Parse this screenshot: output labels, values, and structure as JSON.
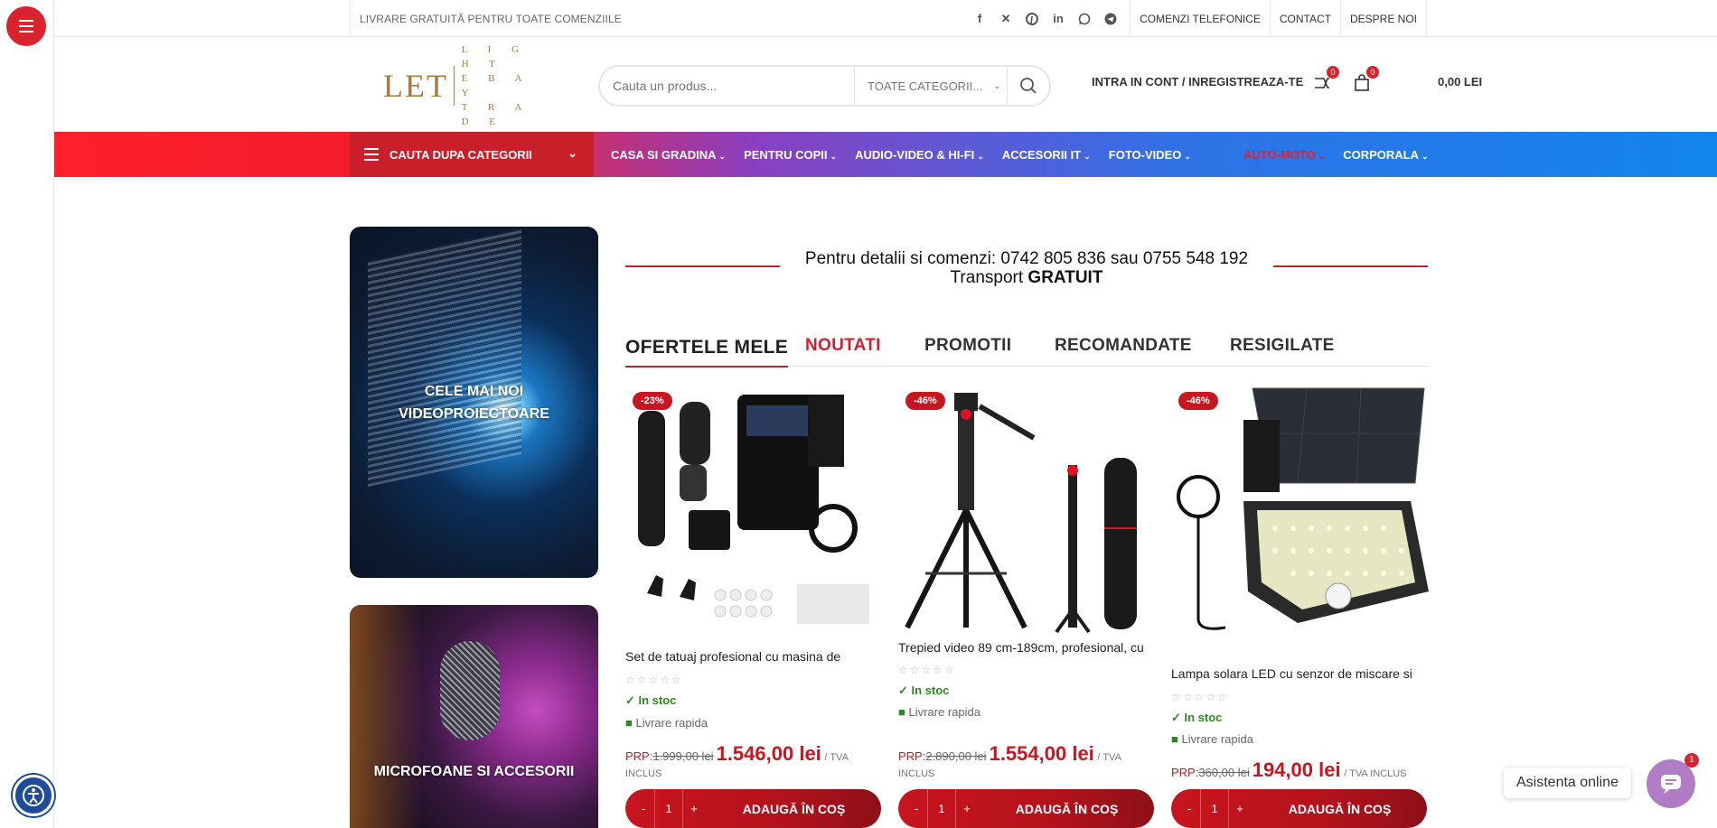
{
  "topbar": {
    "promo": "LIVRARE GRATUITĂ PENTRU TOATE COMENZIILE",
    "social_icons": [
      "facebook-icon",
      "x-icon",
      "pinterest-icon",
      "linkedin-icon",
      "whatsapp-icon",
      "telegram-icon"
    ],
    "links": [
      "COMENZI TELEFONICE",
      "CONTACT",
      "DESPRE NOI"
    ]
  },
  "header": {
    "logo_main": "LET",
    "logo_lines": [
      "L I G H T",
      "E B A Y",
      "T R A D E"
    ],
    "search_placeholder": "Cauta un produs...",
    "category_select": "TOATE CATEGORII...",
    "account": "INTRA IN CONT / INREGISTREAZA-TE",
    "compare_count": "0",
    "cart_count": "0",
    "cart_total": "0,00 LEI"
  },
  "nav": {
    "category_button": "CAUTA DUPA CATEGORII",
    "items": [
      "CASA SI GRADINA",
      "PENTRU COPII",
      "AUDIO-VIDEO & HI-FI",
      "ACCESORII IT",
      "FOTO-VIDEO"
    ],
    "right_items": [
      "AUTO-MOTO",
      "CORPORALA"
    ]
  },
  "banners": [
    {
      "line1": "CELE MAI NOI",
      "line2": "VIDEOPROIECTOARE"
    },
    {
      "line1": "MICROFOANE SI ACCESORII",
      "line2": ""
    }
  ],
  "contact": {
    "line1": "Pentru detalii si comenzi: 0742 805 836 sau 0755 548 192",
    "line2_prefix": "Transport ",
    "line2_bold": "GRATUIT"
  },
  "tabs": [
    "OFERTELE MELE",
    "NOUTATI",
    "PROMOTII",
    "RECOMANDATE",
    "RESIGILATE"
  ],
  "products": [
    {
      "discount": "-23%",
      "title": "Set de tatuaj profesional cu masina de",
      "stars": "☆☆☆☆☆",
      "stock": "In stoc",
      "shipping": "Livrare rapida",
      "prp_label": "PRP:",
      "old_price": "1.999,00 lei",
      "price": "1.546,00 lei",
      "tva1": "/ TVA",
      "tva2": "INCLUS",
      "qty": "1",
      "add": "ADAUGĂ ÎN COȘ"
    },
    {
      "discount": "-46%",
      "title": "Trepied video 89 cm-189cm, profesional, cu",
      "stars": "☆☆☆☆☆",
      "stock": "In stoc",
      "shipping": "Livrare rapida",
      "prp_label": "PRP:",
      "old_price": "2.890,00 lei",
      "price": "1.554,00 lei",
      "tva1": "/ TVA",
      "tva2": "INCLUS",
      "qty": "1",
      "add": "ADAUGĂ ÎN COȘ"
    },
    {
      "discount": "-46%",
      "title": "Lampa solara LED cu senzor de miscare si",
      "stars": "☆☆☆☆☆",
      "stock": "In stoc",
      "shipping": "Livrare rapida",
      "prp_label": "PRP:",
      "old_price": "360,00 lei",
      "price": "194,00 lei",
      "tva1": "/ TVA INCLUS",
      "tva2": "",
      "qty": "1",
      "add": "ADAUGĂ ÎN COȘ"
    }
  ],
  "chat": {
    "label": "Asistenta online",
    "badge": "1"
  },
  "colors": {
    "accent": "#c8151f",
    "stock": "#2b8a1e",
    "logo": "#a77b3f"
  }
}
